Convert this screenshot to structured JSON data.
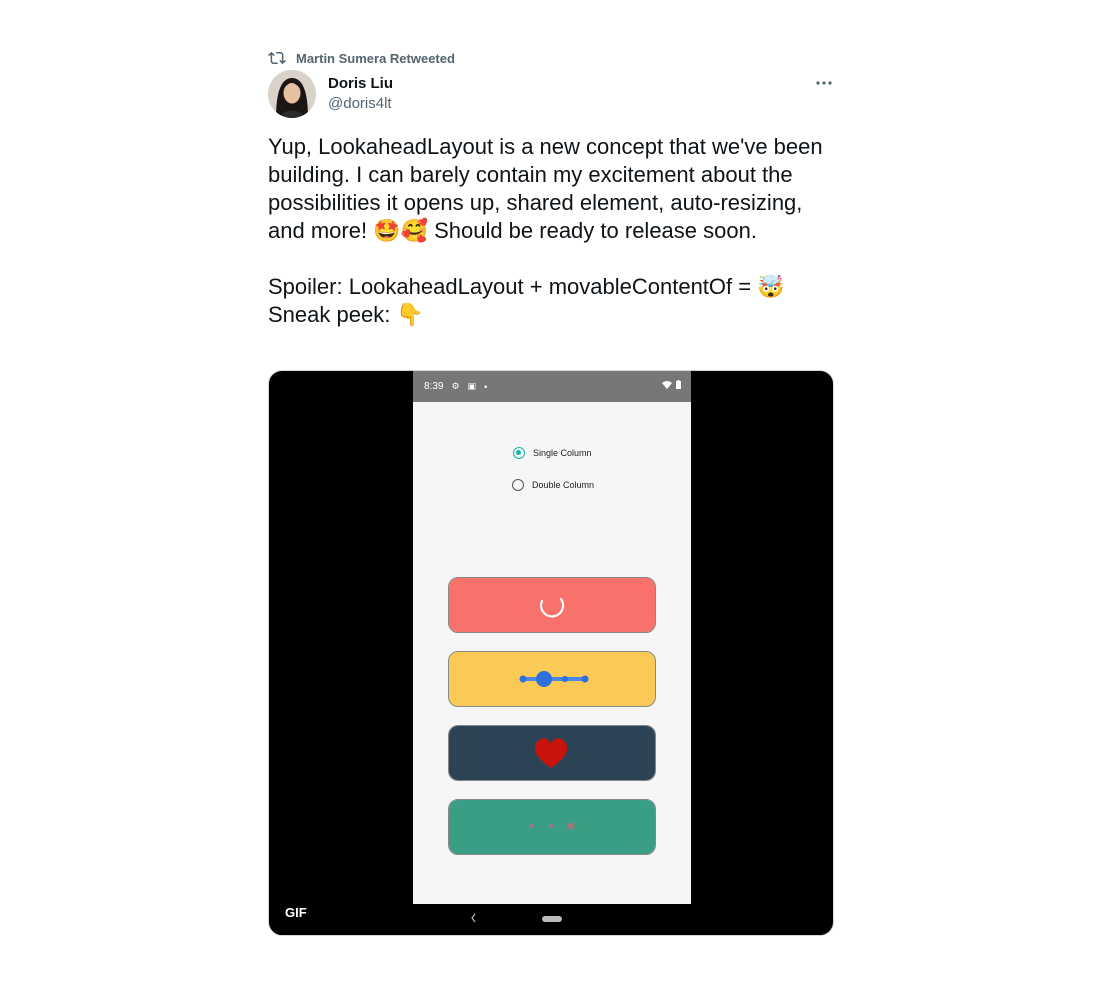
{
  "retweet": {
    "text": "Martin Sumera Retweeted",
    "icon": "retweet-icon"
  },
  "author": {
    "display_name": "Doris Liu",
    "handle": "@doris4lt"
  },
  "more_menu": {
    "icon": "more-icon",
    "label": "···"
  },
  "tweet": {
    "paragraph1": "Yup, LookaheadLayout is a new concept that we've been building. I can barely contain my excitement about the possibilities it opens up, shared element, auto-resizing, and more! 🤩🥰 Should be ready to release soon.",
    "paragraph2_line1": "Spoiler: LookaheadLayout + movableContentOf = 🤯",
    "paragraph2_line2": "Sneak peek: 👇"
  },
  "media": {
    "badge": "GIF",
    "phone": {
      "status_time": "8:39",
      "radio_options": [
        {
          "label": "Single Column",
          "checked": true
        },
        {
          "label": "Double Column",
          "checked": false
        }
      ],
      "cards": [
        {
          "color": "#f8716a",
          "content": "spinner"
        },
        {
          "color": "#fbc955",
          "content": "slider"
        },
        {
          "color": "#2c4255",
          "content": "heart"
        },
        {
          "color": "#3a9e86",
          "content": "dots"
        }
      ]
    }
  },
  "colors": {
    "text": "#0f1419",
    "secondary": "#536471",
    "accent": "#13b8a6"
  }
}
